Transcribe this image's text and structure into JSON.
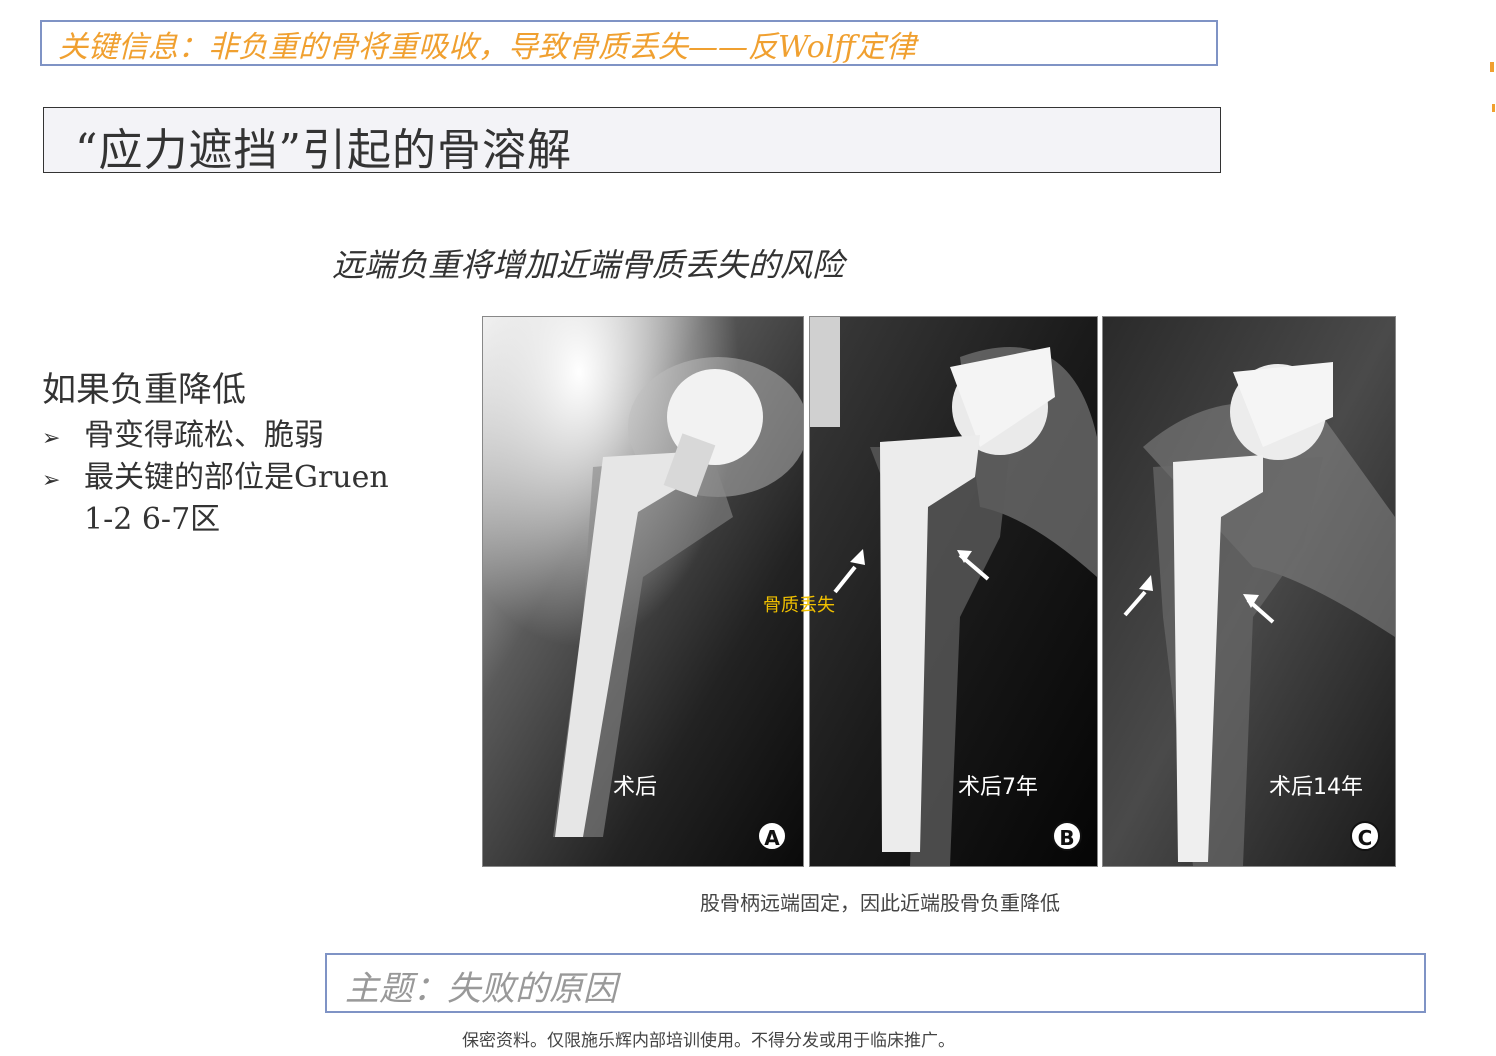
{
  "key_info": "关键信息：非负重的骨将重吸收，导致骨质丢失——反Wolff定律",
  "title": "“应力遮挡”引起的骨溶解",
  "subtitle": "远端负重将增加近端骨质丢失的风险",
  "left": {
    "heading": "如果负重降低",
    "bullets": [
      "骨变得疏松、脆弱",
      "最关键的部位是Gruen"
    ],
    "bullet_cont": "1-2  6-7区",
    "bullet_marker": "➢"
  },
  "figure": {
    "panels": [
      {
        "caption": "术后",
        "badge": "A"
      },
      {
        "caption": "术后7年",
        "badge": "B"
      },
      {
        "caption": "术后14年",
        "badge": "C"
      }
    ],
    "annotation": "骨质丢失",
    "caption": "股骨柄远端固定，因此近端股骨负重降低"
  },
  "theme": "主题：失败的原因",
  "footer": "保密资料。仅限施乐辉内部培训使用。不得分发或用于临床推广。",
  "colors": {
    "key_text": "#f0a030",
    "box_border": "#7f93c5",
    "theme_text": "#999999",
    "annotation": "#f0c000"
  }
}
